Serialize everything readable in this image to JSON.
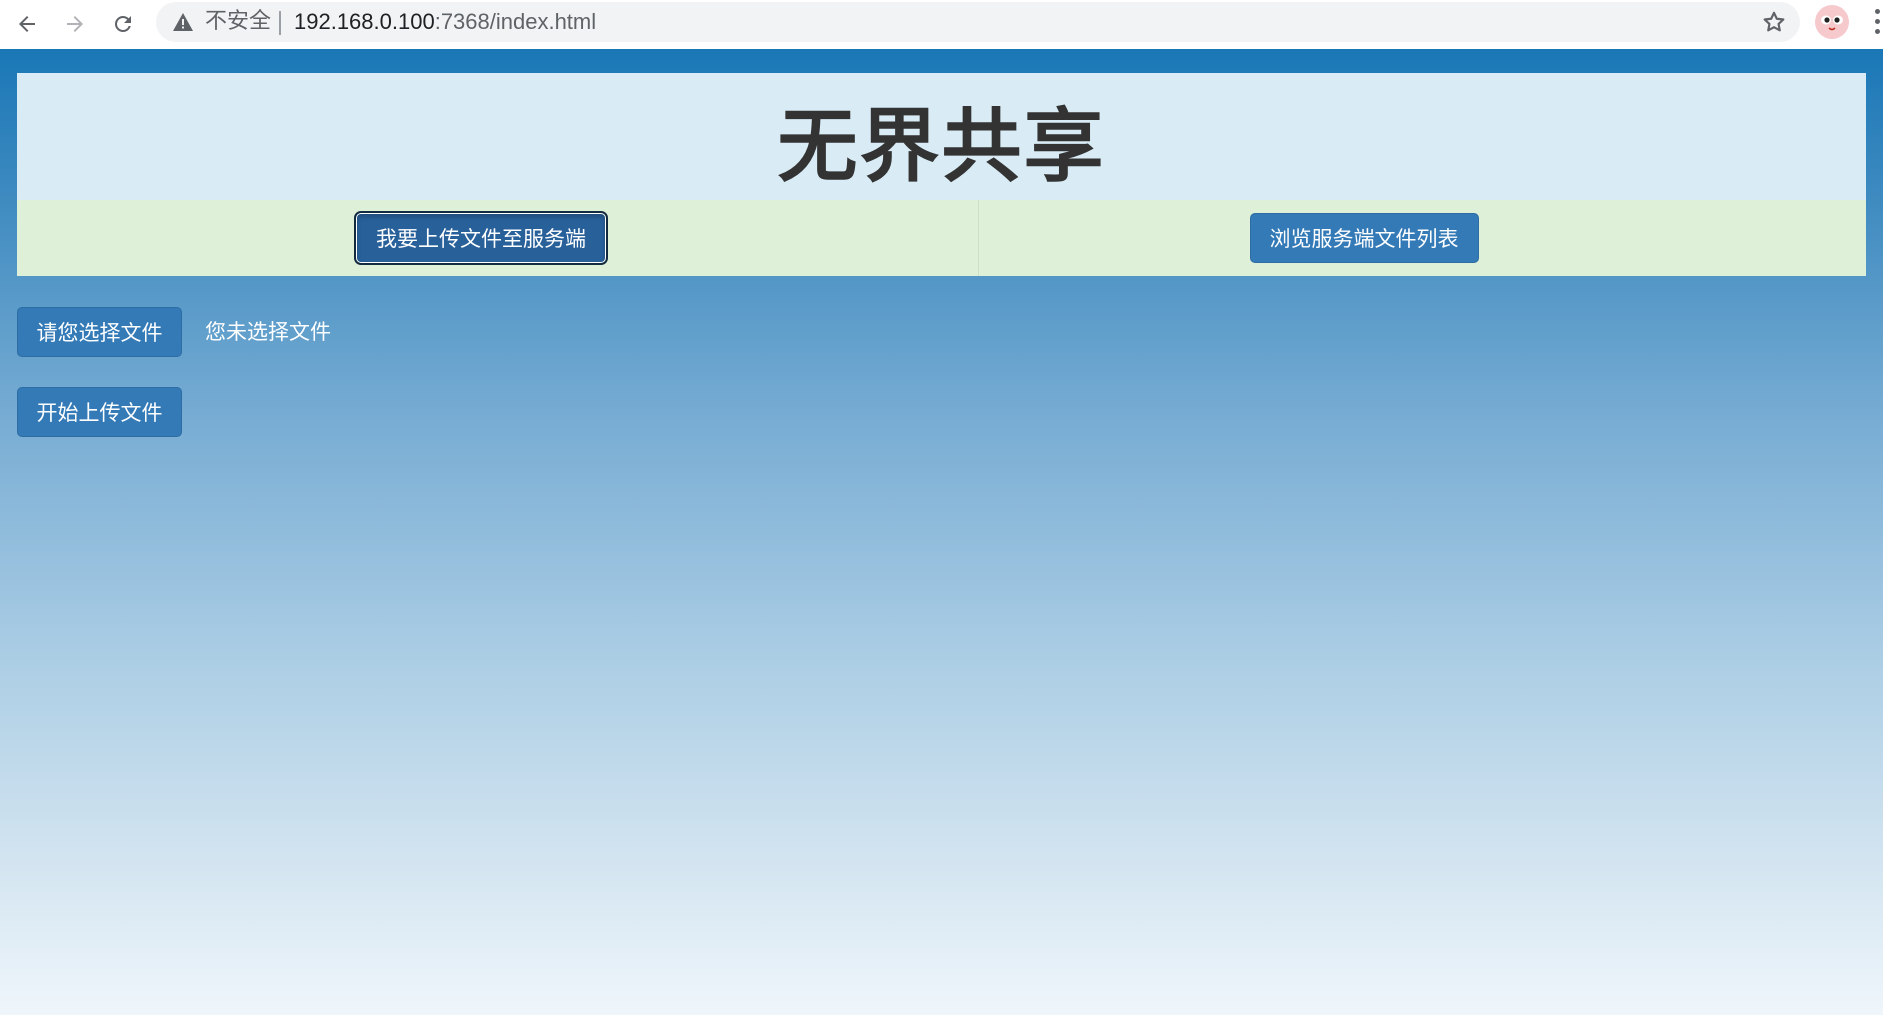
{
  "browser": {
    "security_label": "不安全",
    "url_host": "192.168.0.100",
    "url_port_path": ":7368/index.html"
  },
  "page": {
    "title": "无界共享",
    "nav": {
      "upload_label": "我要上传文件至服务端",
      "browse_label": "浏览服务端文件列表"
    },
    "upload_form": {
      "choose_file_label": "请您选择文件",
      "file_status": "您未选择文件",
      "start_upload_label": "开始上传文件"
    }
  },
  "colors": {
    "primary_button": "#337ab7",
    "header_panel": "#d9ecf6",
    "nav_row": "#dff0d8",
    "title_text": "#333333"
  }
}
